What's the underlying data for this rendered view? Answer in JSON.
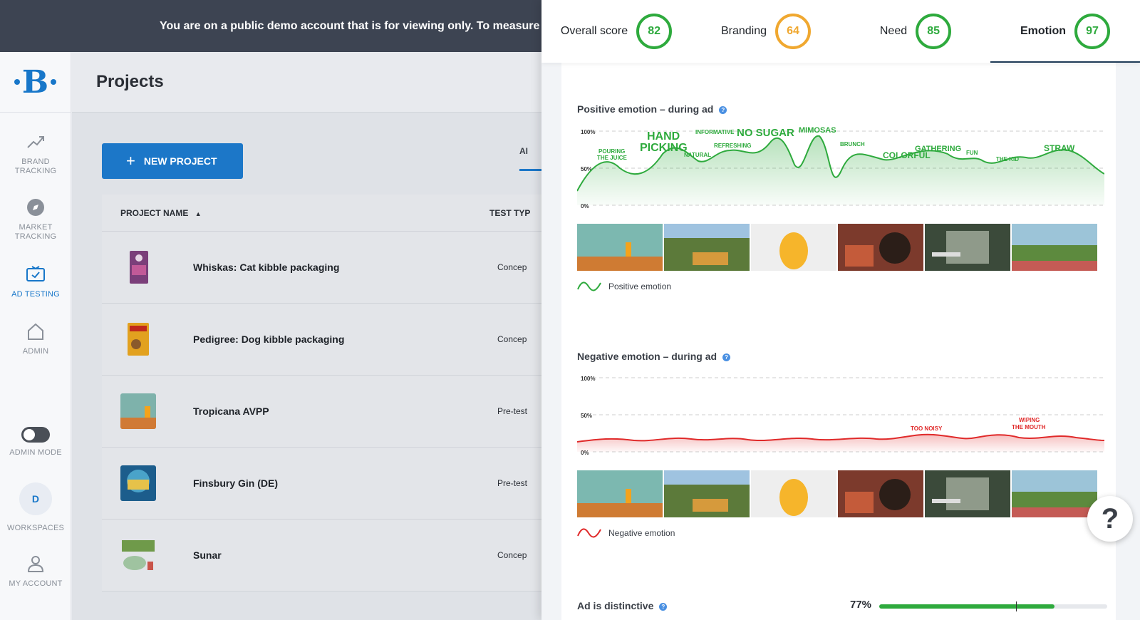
{
  "banner": {
    "text": "You are on a public demo account that is for viewing only. To measure"
  },
  "sidebar": {
    "logo": "B",
    "items": [
      {
        "label_1": "BRAND",
        "label_2": "TRACKING"
      },
      {
        "label_1": "MARKET",
        "label_2": "TRACKING"
      },
      {
        "label_1": "AD TESTING",
        "label_2": ""
      },
      {
        "label_1": "ADMIN",
        "label_2": ""
      }
    ],
    "admin_mode": "ADMIN MODE",
    "workspace_initial": "D",
    "workspaces": "WORKSPACES",
    "my_account": "MY ACCOUNT"
  },
  "main": {
    "title": "Projects",
    "new_project": "NEW PROJECT",
    "tab_stub": "AI",
    "columns": {
      "name": "PROJECT NAME",
      "type": "TEST TYP"
    },
    "rows": [
      {
        "name": "Whiskas: Cat kibble packaging",
        "type": "Concep"
      },
      {
        "name": "Pedigree: Dog kibble packaging",
        "type": "Concep"
      },
      {
        "name": "Tropicana AVPP",
        "type": "Pre-test"
      },
      {
        "name": "Finsbury Gin (DE)",
        "type": "Pre-test"
      },
      {
        "name": "Sunar",
        "type": "Concep"
      }
    ]
  },
  "scores": [
    {
      "label": "Overall score",
      "value": "82",
      "color": "#2eaa3d"
    },
    {
      "label": "Branding",
      "value": "64",
      "color": "#f0a830"
    },
    {
      "label": "Need",
      "value": "85",
      "color": "#2eaa3d"
    },
    {
      "label": "Emotion",
      "value": "97",
      "color": "#2eaa3d"
    }
  ],
  "positive": {
    "title": "Positive emotion – during ad",
    "y_ticks": [
      "100%",
      "50%",
      "0%"
    ],
    "labels": [
      "POURING",
      "THE JUICE",
      "HAND",
      "PICKING",
      "NATURAL",
      "INFORMATIVE",
      "REFRESHING",
      "NO SUGAR",
      "MIMOSAS",
      "BRUNCH",
      "COLORFUL",
      "GATHERING",
      "FUN",
      "THE KID",
      "STRAW"
    ],
    "legend": "Positive emotion",
    "color": "#2eaa3d"
  },
  "negative": {
    "title": "Negative emotion – during ad",
    "y_ticks": [
      "100%",
      "50%",
      "0%"
    ],
    "labels": [
      "TOO NOISY",
      "WIPING",
      "THE MOUTH"
    ],
    "legend": "Negative emotion",
    "color": "#e02a2a"
  },
  "metric": {
    "label": "Ad is distinctive",
    "value": "77%",
    "fraction": 0.77,
    "benchmark": 0.6
  }
}
